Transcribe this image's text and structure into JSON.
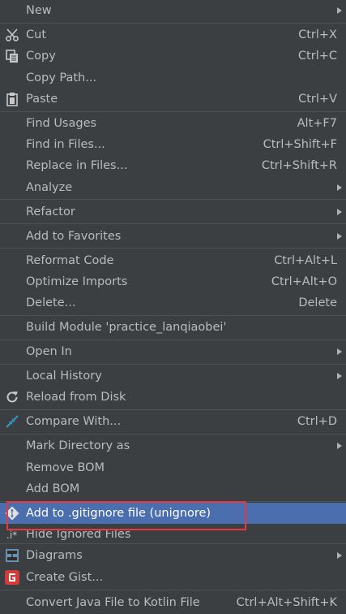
{
  "menu": {
    "new": "New",
    "cut": "Cut",
    "cut_sc": "Ctrl+X",
    "copy": "Copy",
    "copy_sc": "Ctrl+C",
    "copy_path": "Copy Path...",
    "paste": "Paste",
    "paste_sc": "Ctrl+V",
    "find_usages": "Find Usages",
    "find_usages_sc": "Alt+F7",
    "find_in_files": "Find in Files...",
    "find_in_files_sc": "Ctrl+Shift+F",
    "replace_in_files": "Replace in Files...",
    "replace_in_files_sc": "Ctrl+Shift+R",
    "analyze": "Analyze",
    "refactor": "Refactor",
    "add_to_favorites": "Add to Favorites",
    "reformat_code": "Reformat Code",
    "reformat_code_sc": "Ctrl+Alt+L",
    "optimize_imports": "Optimize Imports",
    "optimize_imports_sc": "Ctrl+Alt+O",
    "delete": "Delete...",
    "delete_sc": "Delete",
    "build_module": "Build Module 'practice_lanqiaobei'",
    "open_in": "Open In",
    "local_history": "Local History",
    "reload_from_disk": "Reload from Disk",
    "compare_with": "Compare With...",
    "compare_with_sc": "Ctrl+D",
    "mark_directory_as": "Mark Directory as",
    "remove_bom": "Remove BOM",
    "add_bom": "Add BOM",
    "add_to_gitignore": "Add to .gitignore file (unignore)",
    "hide_ignored_files": "Hide Ignored Files",
    "diagrams": "Diagrams",
    "create_gist": "Create Gist...",
    "convert_java_kotlin": "Convert Java File to Kotlin File",
    "convert_java_kotlin_sc": "Ctrl+Alt+Shift+K"
  },
  "colors": {
    "background": "#3c3f41",
    "highlight": "#4b6eaf",
    "text": "#bbbbbb",
    "annotation_box": "#e8383d"
  }
}
